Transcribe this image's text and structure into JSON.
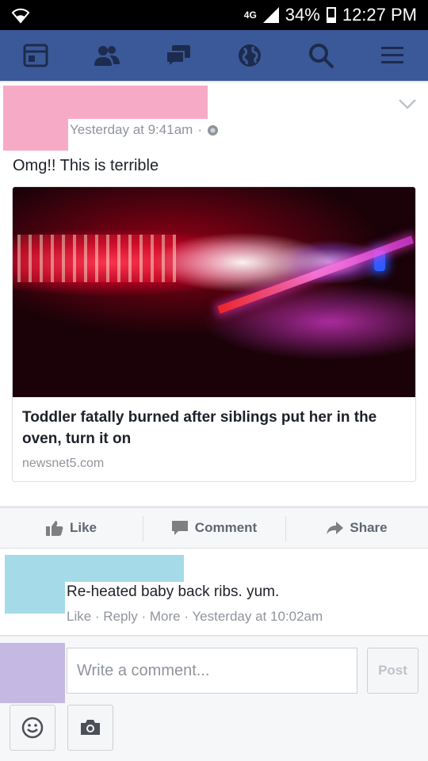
{
  "status_bar": {
    "network": "4G",
    "battery": "34%",
    "time": "12:27 PM"
  },
  "navbar": {
    "items": [
      "news-feed-icon",
      "friends-icon",
      "messages-icon",
      "globe-icon",
      "search-icon",
      "menu-icon"
    ]
  },
  "post": {
    "timestamp": "Yesterday at 9:41am",
    "separator": "·",
    "text": "Omg!! This is terrible",
    "link": {
      "title": "Toddler fatally burned after siblings put her in the oven, turn it on",
      "domain": "newsnet5.com"
    }
  },
  "actions": {
    "like": "Like",
    "comment": "Comment",
    "share": "Share"
  },
  "comment": {
    "text": "Re-heated baby back ribs. yum.",
    "meta": "Like · Reply · More · Yesterday at 10:02am"
  },
  "composer": {
    "placeholder": "Write a comment...",
    "post_label": "Post"
  },
  "colors": {
    "brand": "#3b5998",
    "redaction_author": "#f7aac6",
    "redaction_commenter": "#a5dbe8",
    "redaction_self": "#c5b9e3"
  }
}
